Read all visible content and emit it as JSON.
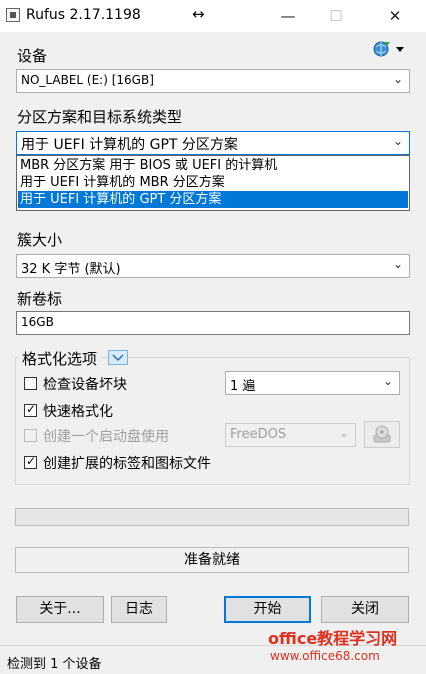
{
  "window": {
    "title": "Rufus 2.17.1198",
    "resize_glyph": "↔",
    "minimize": "—",
    "maximize": "☐",
    "close": "✕"
  },
  "device": {
    "label": "设备",
    "value": "NO_LABEL (E:) [16GB]",
    "lang_icon": "globe-language-icon"
  },
  "partition": {
    "label": "分区方案和目标系统类型",
    "value": "用于 UEFI 计算机的 GPT 分区方案",
    "options": [
      "MBR 分区方案 用于 BIOS 或 UEFI 的计算机",
      "用于 UEFI 计算机的 MBR 分区方案",
      "用于 UEFI 计算机的 GPT 分区方案"
    ],
    "selected_index": 2
  },
  "cluster": {
    "label": "簇大小",
    "value": "32 K 字节 (默认)"
  },
  "volume": {
    "label": "新卷标",
    "value": "16GB"
  },
  "format_options": {
    "label": "格式化选项",
    "check_bad_blocks": {
      "label": "检查设备坏块",
      "checked": false
    },
    "passes": "1 遍",
    "quick_format": {
      "label": "快速格式化",
      "checked": true
    },
    "bootable": {
      "label": "创建一个启动盘使用",
      "checked": false,
      "disabled": true
    },
    "boot_type": "FreeDOS",
    "extended_label": {
      "label": "创建扩展的标签和图标文件",
      "checked": true
    }
  },
  "progress": {
    "fraction": 0.0
  },
  "status": {
    "text": "准备就绪"
  },
  "buttons": {
    "about": "关于...",
    "log": "日志",
    "start": "开始",
    "close": "关闭"
  },
  "statusbar": {
    "text": "检测到 1 个设备"
  },
  "watermark": {
    "line1": "office教程学习网",
    "line2": "www.office68.com",
    "color": "#e0301e"
  }
}
